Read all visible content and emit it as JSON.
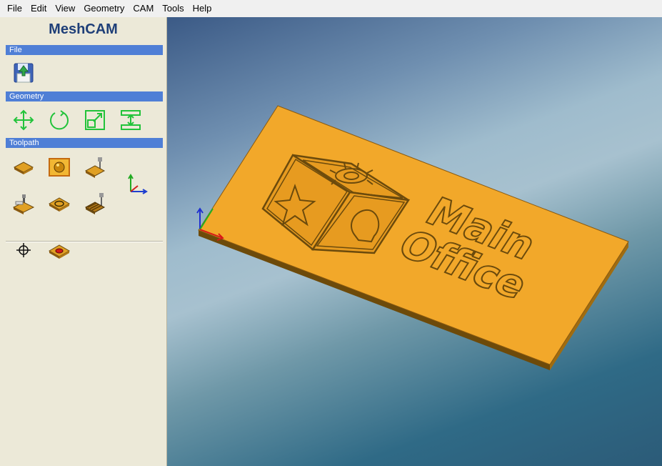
{
  "menu": [
    "File",
    "Edit",
    "View",
    "Geometry",
    "CAM",
    "Tools",
    "Help"
  ],
  "app_title": "MeshCAM",
  "sections": {
    "file": "File",
    "geometry": "Geometry",
    "toolpath": "Toolpath"
  },
  "model": {
    "line1": "Main",
    "line2": "Office"
  },
  "colors": {
    "section_header": "#4f7fd6",
    "geometry_icon": "#22c33a",
    "model_face": "#f2a82a"
  }
}
